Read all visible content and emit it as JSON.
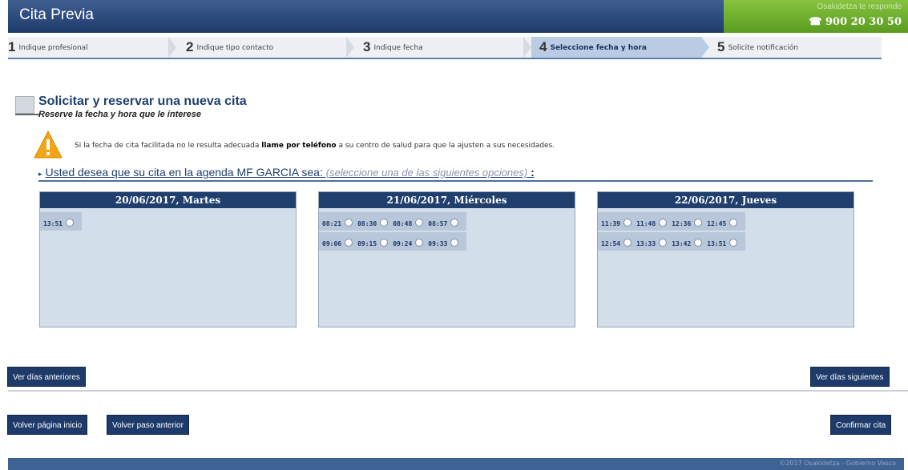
{
  "header": {
    "title": "Cita Previa",
    "phone_tagline": "Osakidetza te responde",
    "phone_number": "☎ 900 20 30 50",
    "accent_color": "#6fb02e",
    "brand_color": "#1d3a6a"
  },
  "steps": [
    {
      "num": "1",
      "label": "Indique profesional"
    },
    {
      "num": "2",
      "label": "Indique tipo contacto"
    },
    {
      "num": "3",
      "label": "Indique fecha"
    },
    {
      "num": "4",
      "label": "Seleccione fecha y hora"
    },
    {
      "num": "5",
      "label": "Solicite notificación"
    }
  ],
  "section": {
    "title": "Solicitar y reservar una nueva cita",
    "subtitle": "Reserve la fecha y hora que le interese"
  },
  "warning": {
    "before": "Si la fecha de cita facilitada no le resulta adecuada ",
    "bold": "llame por teléfono",
    "after": " a su centro de salud para que la ajusten a sus necesidades."
  },
  "agenda": {
    "title": "Usted desea que su cita en la agenda MF GARCIA sea:",
    "hint": "(seleccione una de las siguientes opciones)",
    "colon": ":"
  },
  "days": [
    {
      "label": "20/06/2017, Martes",
      "rows": [
        [
          "13:51"
        ]
      ]
    },
    {
      "label": "21/06/2017, Miércoles",
      "rows": [
        [
          "08:21",
          "08:30",
          "08:48",
          "08:57"
        ],
        [
          "09:06",
          "09:15",
          "09:24",
          "09:33"
        ]
      ]
    },
    {
      "label": "22/06/2017, Jueves",
      "rows": [
        [
          "11:39",
          "11:48",
          "12:36",
          "12:45"
        ],
        [
          "12:54",
          "13:33",
          "13:42",
          "13:51"
        ]
      ]
    }
  ],
  "buttons": {
    "prev_days": "Ver días anteriores",
    "next_days": "Ver días siguientes",
    "home": "Volver página inicio",
    "prev_step": "Volver paso anterior",
    "confirm": "Confirmar cita"
  },
  "footer": {
    "text": "©2017 Osakidetza - Gobierno Vasco"
  }
}
